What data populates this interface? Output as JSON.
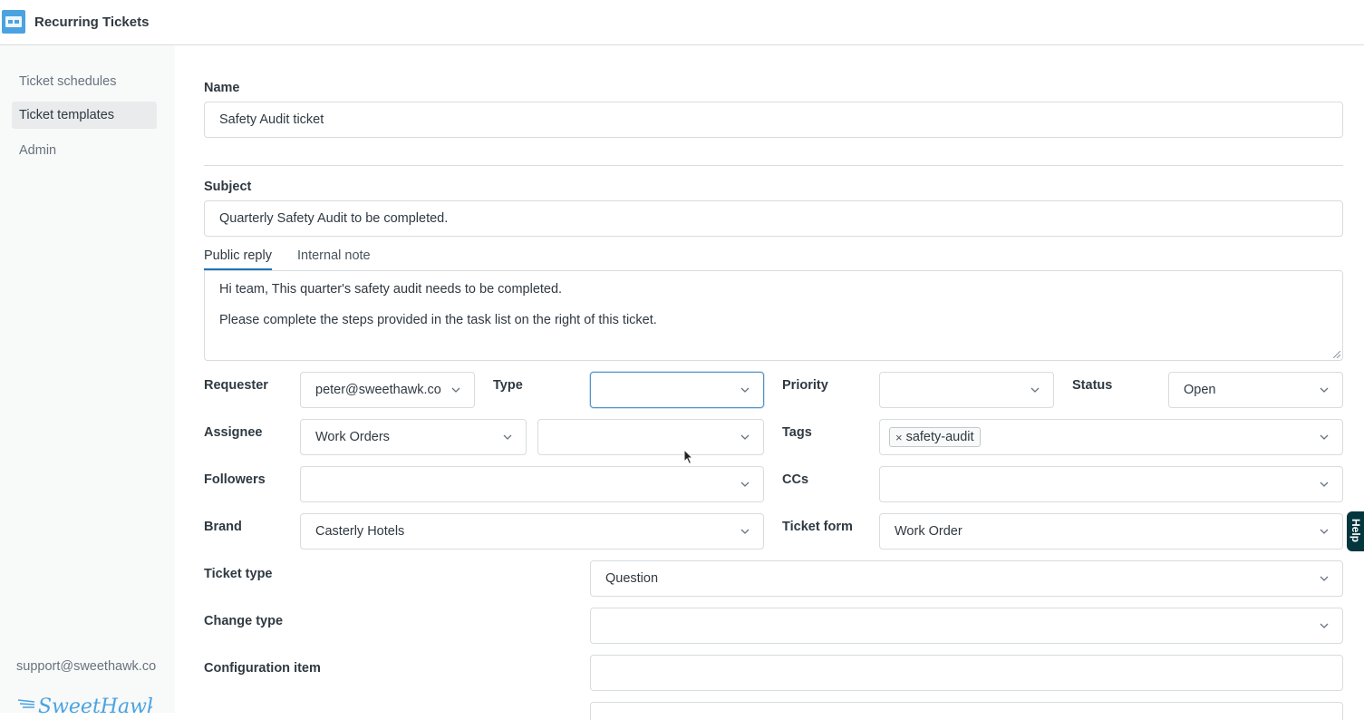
{
  "app": {
    "title": "Recurring Tickets",
    "accent": "#4aa3e0"
  },
  "sidebar": {
    "items": [
      {
        "label": "Ticket schedules",
        "active": false
      },
      {
        "label": "Ticket templates",
        "active": true
      },
      {
        "label": "Admin",
        "active": false
      }
    ],
    "support_email": "support@sweethawk.co",
    "brand_logo": "SweetHawk"
  },
  "form": {
    "name": {
      "label": "Name",
      "value": "Safety Audit ticket"
    },
    "subject": {
      "label": "Subject",
      "value": "Quarterly Safety Audit to be completed."
    },
    "tabs": [
      {
        "label": "Public reply",
        "active": true
      },
      {
        "label": "Internal note",
        "active": false
      }
    ],
    "body": {
      "line1": "Hi team, This quarter's safety audit needs to be completed.",
      "line2": "Please complete the steps provided in the task list on the right of this ticket."
    },
    "requester": {
      "label": "Requester",
      "value": "peter@sweethawk.co"
    },
    "type": {
      "label": "Type",
      "value": ""
    },
    "priority": {
      "label": "Priority",
      "value": ""
    },
    "status": {
      "label": "Status",
      "value": "Open"
    },
    "assignee": {
      "label": "Assignee",
      "group": "Work Orders",
      "agent": ""
    },
    "tags": {
      "label": "Tags",
      "values": [
        "safety-audit"
      ]
    },
    "followers": {
      "label": "Followers",
      "value": ""
    },
    "ccs": {
      "label": "CCs",
      "value": ""
    },
    "brand": {
      "label": "Brand",
      "value": "Casterly Hotels"
    },
    "ticket_form": {
      "label": "Ticket form",
      "value": "Work Order"
    },
    "ticket_type": {
      "label": "Ticket type",
      "value": "Question"
    },
    "change_type": {
      "label": "Change type",
      "value": ""
    },
    "configuration_item": {
      "label": "Configuration item",
      "value": ""
    }
  },
  "help": {
    "label": "Help"
  }
}
